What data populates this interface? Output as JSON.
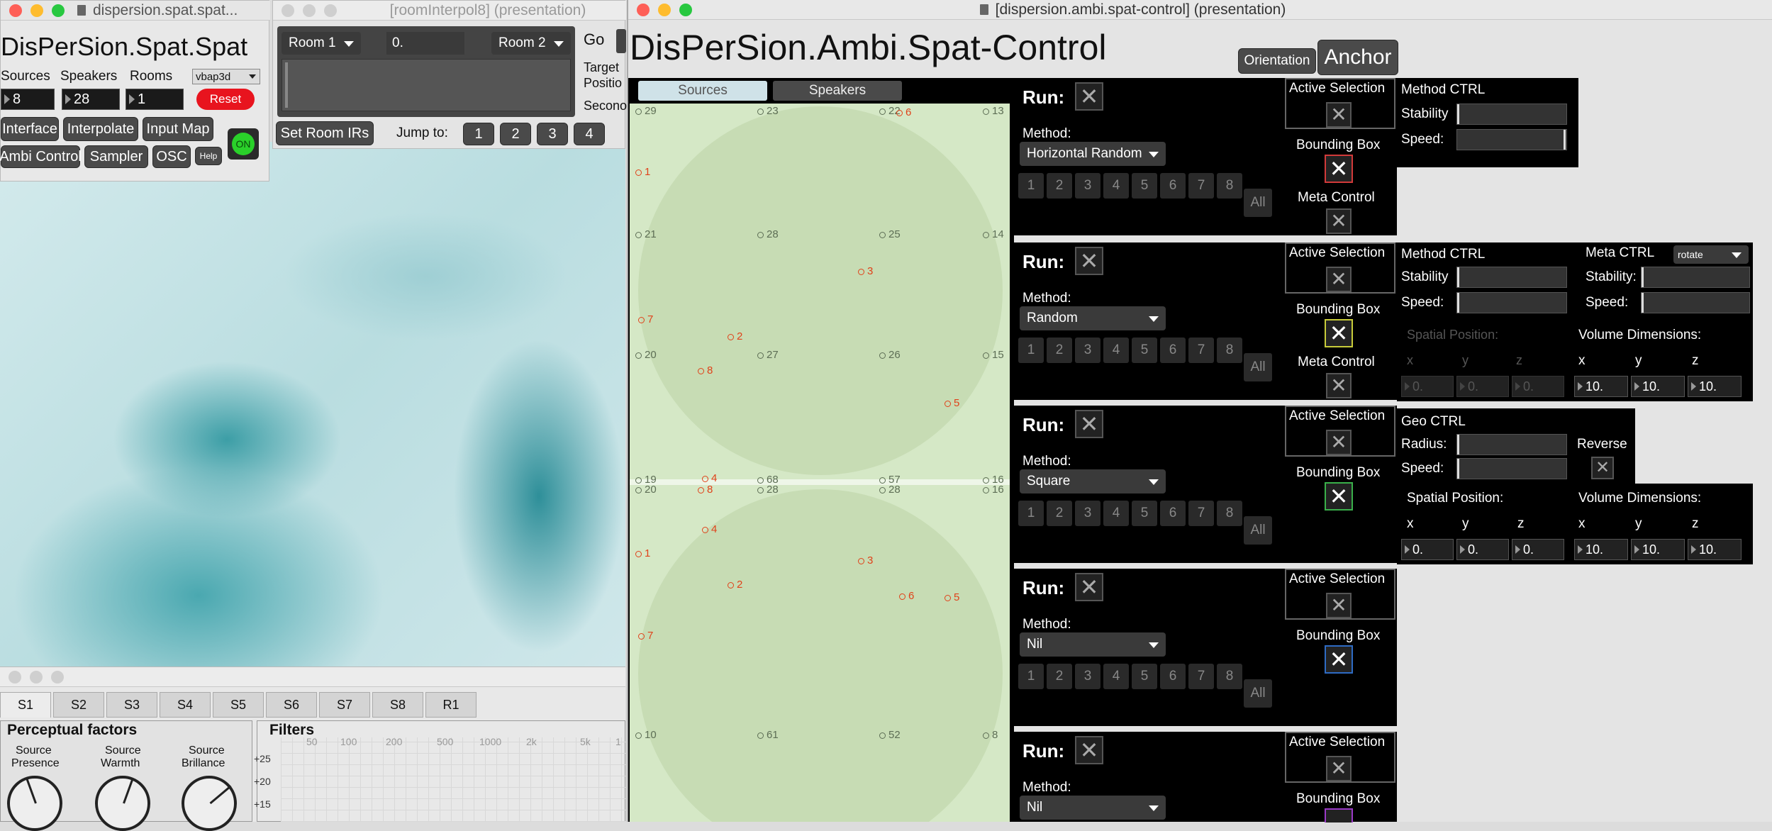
{
  "left_window": {
    "title": "dispersion.spat.spat...",
    "heading": "DisPerSion.Spat.Spat",
    "labels": {
      "sources": "Sources",
      "speakers": "Speakers",
      "rooms": "Rooms"
    },
    "values": {
      "sources": "8",
      "speakers": "28",
      "rooms": "1"
    },
    "mode": "vbap3d",
    "reset": "Reset",
    "toggle": "ON",
    "buttons": [
      "Interface",
      "Interpolate",
      "Input Map",
      "Ambi Control",
      "Sampler",
      "OSC",
      "Help"
    ]
  },
  "room_window": {
    "title": "[roomInterpol8] (presentation)",
    "room1": "Room 1",
    "value": "0.",
    "room2": "Room 2",
    "go": "Go",
    "target": "Target",
    "position": "Positio",
    "seconds": "Secono",
    "set_room_irs": "Set Room IRs",
    "jump_to": "Jump to:",
    "jumps": [
      "1",
      "2",
      "3",
      "4"
    ]
  },
  "bottom_window": {
    "tabs": [
      "S1",
      "S2",
      "S3",
      "S4",
      "S5",
      "S6",
      "S7",
      "S8",
      "R1"
    ],
    "perceptual": "Perceptual factors",
    "knobs": [
      {
        "line1": "Source",
        "line2": "Presence"
      },
      {
        "line1": "Source",
        "line2": "Warmth"
      },
      {
        "line1": "Source",
        "line2": "Brillance"
      }
    ],
    "filters": "Filters",
    "freqs": [
      "50",
      "100",
      "200",
      "500",
      "1000",
      "2k",
      "5k",
      "1"
    ],
    "db": [
      "+25",
      "+20",
      "+15"
    ]
  },
  "right_window": {
    "title": "[dispersion.ambi.spat-control] (presentation)",
    "heading": "DisPerSion.Ambi.Spat-Control",
    "orientation": "Orientation",
    "anchor": "Anchor",
    "tabs": {
      "sources": "Sources",
      "speakers": "Speakers"
    },
    "common": {
      "run": "Run:",
      "method": "Method:",
      "active_selection": "Active Selection",
      "bounding_box": "Bounding Box",
      "meta_control": "Meta Control",
      "nums": [
        "1",
        "2",
        "3",
        "4",
        "5",
        "6",
        "7",
        "8"
      ],
      "all": "All",
      "method_ctrl": "Method CTRL",
      "stability": "Stability",
      "speed": "Speed:",
      "meta_ctrl": "Meta CTRL",
      "meta_mode": "rotate",
      "stability_colon": "Stability:",
      "spatial_position": "Spatial Position:",
      "volume_dimensions": "Volume Dimensions:",
      "x": "x",
      "y": "y",
      "z": "z",
      "geo_ctrl": "Geo CTRL",
      "radius": "Radius:",
      "reverse": "Reverse",
      "zero": "0.",
      "ten": "10."
    },
    "rows": [
      {
        "method": "Horizontal Random",
        "bbox_color": "#d23a3a"
      },
      {
        "method": "Random",
        "bbox_color": "#c8cc3a"
      },
      {
        "method": "Square",
        "bbox_color": "#3ab04a"
      },
      {
        "method": "Nil",
        "bbox_color": "#2e6bc4"
      },
      {
        "method": "Nil",
        "bbox_color": "#9b3ac8"
      }
    ]
  },
  "sim": {
    "top_speakers": [
      "29",
      "23",
      "22",
      "13",
      "21",
      "28",
      "25",
      "14",
      "20",
      "27",
      "26",
      "15",
      "19",
      "68",
      "57",
      "16"
    ],
    "bottom_speakers": [
      "20",
      "28",
      "28",
      "16",
      "10",
      "61",
      "52",
      "8"
    ],
    "top_sources": [
      "6",
      "1",
      "3",
      "7",
      "2",
      "8",
      "5",
      "4"
    ],
    "bottom_sources": [
      "8",
      "4",
      "1",
      "3",
      "2",
      "6",
      "5",
      "7"
    ]
  },
  "colors": {
    "accent_red": "#e0421a",
    "sim_bg": "#d5e8c6",
    "circle": "#c7dcb4"
  }
}
